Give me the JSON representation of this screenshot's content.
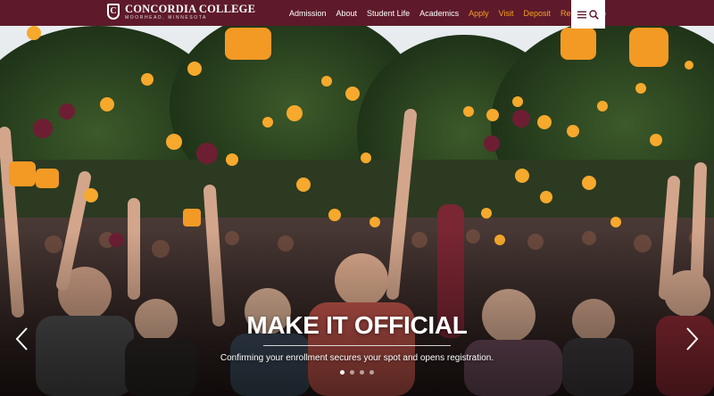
{
  "header": {
    "logo_name": "CONCORDIA COLLEGE",
    "logo_sub": "MOORHEAD, MINNESOTA",
    "logo_mark": "C",
    "brand_color": "#5e1a2a",
    "accent_color": "#f7a21b",
    "nav": [
      {
        "label": "Admission",
        "accent": false
      },
      {
        "label": "About",
        "accent": false
      },
      {
        "label": "Student Life",
        "accent": false
      },
      {
        "label": "Academics",
        "accent": false
      },
      {
        "label": "Apply",
        "accent": true
      },
      {
        "label": "Visit",
        "accent": true
      },
      {
        "label": "Deposit",
        "accent": true
      },
      {
        "label": "Request Info",
        "accent": true
      }
    ],
    "menu_icons": [
      "menu-icon",
      "search-icon"
    ]
  },
  "hero": {
    "title": "MAKE IT OFFICIAL",
    "subtitle": "Confirming your enrollment secures your spot and opens registration.",
    "slide_count": 4,
    "active_slide": 1
  }
}
